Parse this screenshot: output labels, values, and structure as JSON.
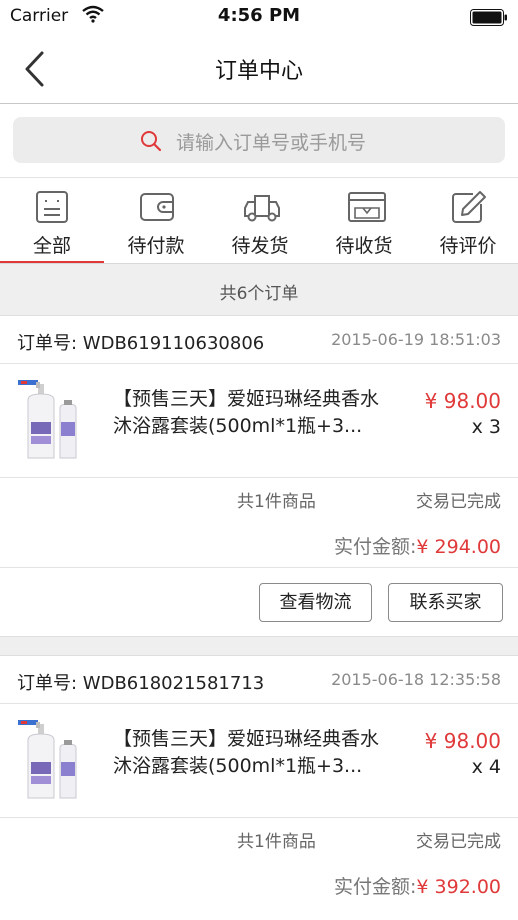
{
  "status_bar": {
    "carrier": "Carrier",
    "time": "4:56 PM"
  },
  "nav": {
    "title": "订单中心"
  },
  "search": {
    "placeholder": "请输入订单号或手机号"
  },
  "tabs": [
    {
      "label": "全部",
      "icon": "all-orders-icon",
      "active": true
    },
    {
      "label": "待付款",
      "icon": "wallet-icon"
    },
    {
      "label": "待发货",
      "icon": "truck-icon"
    },
    {
      "label": "待收货",
      "icon": "package-receive-icon"
    },
    {
      "label": "待评价",
      "icon": "edit-icon"
    }
  ],
  "order_count_text": "共6个订单",
  "colors": {
    "accent": "#e0393a"
  },
  "orders": [
    {
      "order_no": "订单号: WDB619110630806",
      "time": "2015-06-19 18:51:03",
      "product_name": "【预售三天】爱姬玛琳经典香水沐浴露套装(500ml*1瓶+3...",
      "price": "¥ 98.00",
      "quantity": "x 3",
      "item_count": "共1件商品",
      "status": "交易已完成",
      "paid_label": "实付金额:",
      "paid_amount": "¥ 294.00",
      "btn_logistics": "查看物流",
      "btn_contact": "联系买家"
    },
    {
      "order_no": "订单号: WDB618021581713",
      "time": "2015-06-18 12:35:58",
      "product_name": "【预售三天】爱姬玛琳经典香水沐浴露套装(500ml*1瓶+3...",
      "price": "¥ 98.00",
      "quantity": "x 4",
      "item_count": "共1件商品",
      "status": "交易已完成",
      "paid_label": "实付金额:",
      "paid_amount": "¥ 392.00"
    }
  ]
}
